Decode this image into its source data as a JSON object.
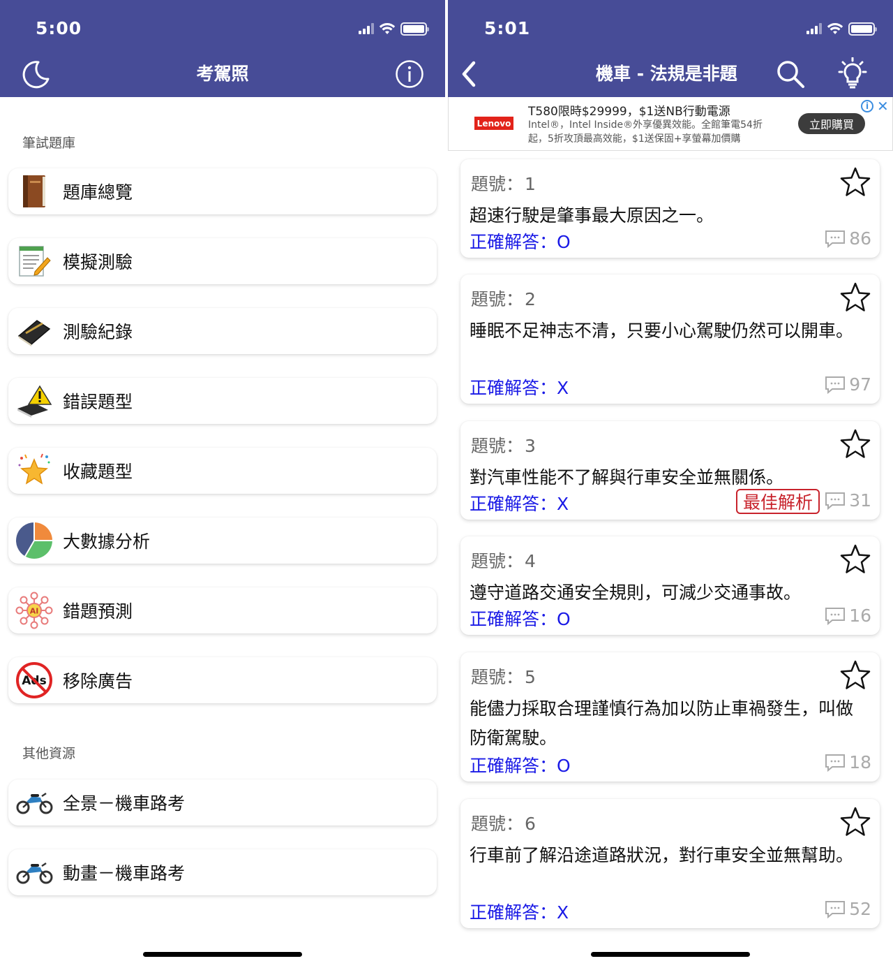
{
  "left": {
    "status": {
      "time": "5:00"
    },
    "nav": {
      "title": "考駕照",
      "left_icon": "moon-icon",
      "right_icon": "info-icon"
    },
    "sections": [
      {
        "label": "筆試題庫"
      },
      {
        "label": "其他資源"
      }
    ],
    "menu": [
      {
        "label": "題庫總覽",
        "icon": "book-icon"
      },
      {
        "label": "模擬測驗",
        "icon": "notepad-pencil-icon"
      },
      {
        "label": "測驗紀錄",
        "icon": "notebook-pen-icon"
      },
      {
        "label": "錯誤題型",
        "icon": "warning-book-icon"
      },
      {
        "label": "收藏題型",
        "icon": "star-sparkle-icon"
      },
      {
        "label": "大數據分析",
        "icon": "pie-chart-icon"
      },
      {
        "label": "錯題預測",
        "icon": "ai-network-icon"
      },
      {
        "label": "移除廣告",
        "icon": "no-ads-icon"
      }
    ],
    "resources": [
      {
        "label": "全景－機車路考",
        "icon": "motorcycle-icon"
      },
      {
        "label": "動畫－機車路考",
        "icon": "motorcycle-icon"
      }
    ]
  },
  "right": {
    "status": {
      "time": "5:01"
    },
    "nav": {
      "title": "機車 - 法規是非題",
      "back_icon": "chevron-left-icon",
      "search_icon": "search-icon",
      "hint_icon": "lightbulb-icon"
    },
    "ad": {
      "logo": "Lenovo",
      "title": "T580限時$29999，$1送NB行動電源",
      "description": "Intel®，Intel Inside®外享優異效能。全館筆電54折起，5折攻頂最高效能，$1送保固+享螢幕加價購",
      "button": "立即購買",
      "info": "i",
      "close": "✕"
    },
    "question_label": "題號：",
    "answer_label": "正確解答：",
    "best_label": "最佳解析",
    "questions": [
      {
        "number": "1",
        "text": "超速行駛是肇事最大原因之一。",
        "answer": "O",
        "comments": "86",
        "best": false
      },
      {
        "number": "2",
        "text": "睡眠不足神志不清，只要小心駕駛仍然可以開車。",
        "answer": "X",
        "comments": "97",
        "best": false
      },
      {
        "number": "3",
        "text": "對汽車性能不了解與行車安全並無關係。",
        "answer": "X",
        "comments": "31",
        "best": true
      },
      {
        "number": "4",
        "text": "遵守道路交通安全規則，可減少交通事故。",
        "answer": "O",
        "comments": "16",
        "best": false
      },
      {
        "number": "5",
        "text": "能儘力採取合理謹慎行為加以防止車禍發生，叫做防衛駕駛。",
        "answer": "O",
        "comments": "18",
        "best": false
      },
      {
        "number": "6",
        "text": "行車前了解沿途道路狀況，對行車安全並無幫助。",
        "answer": "X",
        "comments": "52",
        "best": false
      }
    ]
  }
}
